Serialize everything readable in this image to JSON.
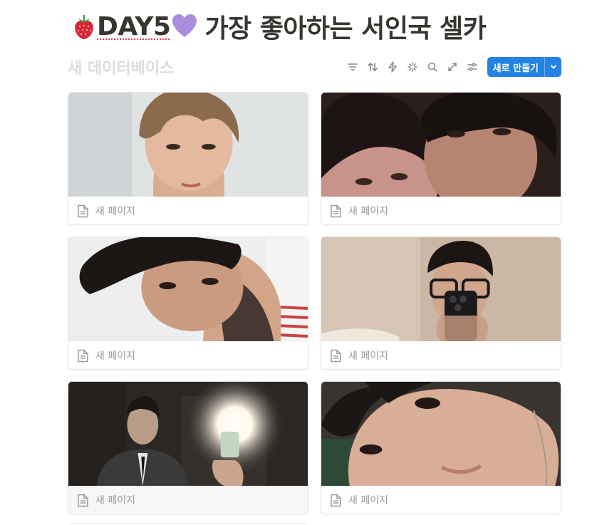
{
  "page": {
    "title_day": "DAY5",
    "title_text": "가장 좋아하는 서인국 셀카",
    "title_emoji_left": "strawberry-icon",
    "title_emoji_right": "purple-heart-icon"
  },
  "database": {
    "title": "새 데이터베이스",
    "toolbar": [
      "filter-icon",
      "sort-icon",
      "automation-icon",
      "ai-sparkle-icon",
      "search-icon",
      "expand-icon",
      "settings-sliders-icon"
    ],
    "new_button_label": "새로 만들기"
  },
  "cards": [
    {
      "title": "새 페이지"
    },
    {
      "title": "새 페이지"
    },
    {
      "title": "새 페이지"
    },
    {
      "title": "새 페이지"
    },
    {
      "title": "새 페이지"
    },
    {
      "title": "새 페이지"
    }
  ]
}
